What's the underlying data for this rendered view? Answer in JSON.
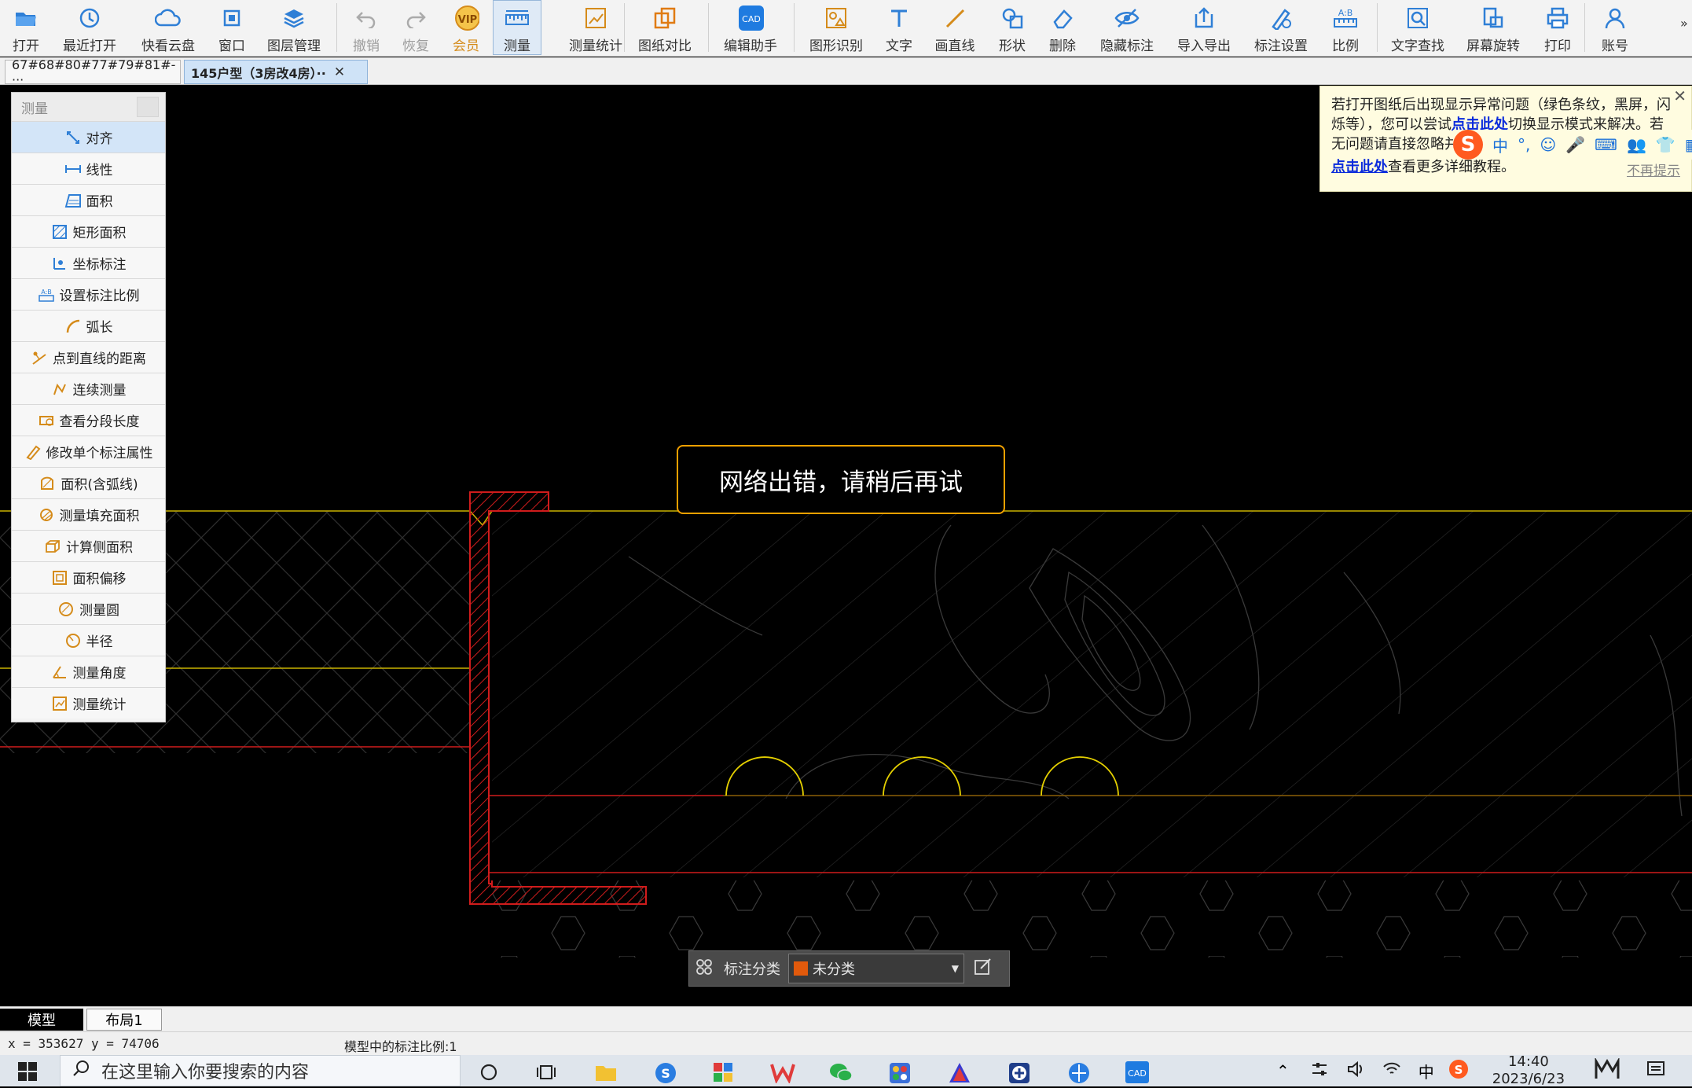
{
  "toolbar": {
    "buttons": [
      {
        "label": "打开",
        "icon": "folder-open-icon"
      },
      {
        "label": "最近打开",
        "icon": "history-icon"
      },
      {
        "label": "快看云盘",
        "icon": "cloud-icon"
      },
      {
        "label": "窗口",
        "icon": "window-icon"
      },
      {
        "label": "图层管理",
        "icon": "layers-icon"
      },
      {
        "label": "撤销",
        "icon": "undo-icon"
      },
      {
        "label": "恢复",
        "icon": "redo-icon"
      },
      {
        "label": "会员",
        "icon": "vip-icon"
      },
      {
        "label": "测量",
        "icon": "ruler-icon"
      },
      {
        "label": "测量统计",
        "icon": "measure-stats-icon"
      },
      {
        "label": "图纸对比",
        "icon": "compare-icon"
      },
      {
        "label": "编辑助手",
        "icon": "cad-edit-icon"
      },
      {
        "label": "图形识别",
        "icon": "shape-recognize-icon"
      },
      {
        "label": "文字",
        "icon": "text-icon"
      },
      {
        "label": "画直线",
        "icon": "line-icon"
      },
      {
        "label": "形状",
        "icon": "shape-icon"
      },
      {
        "label": "删除",
        "icon": "eraser-icon"
      },
      {
        "label": "隐藏标注",
        "icon": "hide-eye-icon"
      },
      {
        "label": "导入导出",
        "icon": "import-export-icon"
      },
      {
        "label": "标注设置",
        "icon": "annotation-settings-icon"
      },
      {
        "label": "比例",
        "icon": "scale-icon"
      },
      {
        "label": "文字查找",
        "icon": "text-search-icon"
      },
      {
        "label": "屏幕旋转",
        "icon": "rotate-screen-icon"
      },
      {
        "label": "打印",
        "icon": "print-icon"
      },
      {
        "label": "账号",
        "icon": "user-icon"
      }
    ],
    "more": "»",
    "vip_badge": "VIP"
  },
  "tabs": [
    {
      "label": "67#68#80#77#79#81#-···",
      "close": "✕"
    },
    {
      "label": "145户型（3房改4房）··",
      "close": "✕"
    }
  ],
  "measure_panel": {
    "title": "测量",
    "items": [
      "对齐",
      "线性",
      "面积",
      "矩形面积",
      "坐标标注",
      "设置标注比例",
      "弧长",
      "点到直线的距离",
      "连续测量",
      "查看分段长度",
      "修改单个标注属性",
      "面积(含弧线)",
      "测量填充面积",
      "计算侧面积",
      "面积偏移",
      "测量圆",
      "半径",
      "测量角度",
      "测量统计"
    ]
  },
  "notice": {
    "line1": "若打开图纸后出现显示异常问题（绿色条纹，黑屏，闪",
    "line2_pre": "烁等），您可以尝试",
    "line2_link": "点击此处",
    "line2_post": "切换显示模式来解决。若",
    "line3": "无问题请直接忽略并",
    "link2": "点击此处",
    "line4_post": "查看更多详细教程。",
    "nomore": "不再提示",
    "close": "✕"
  },
  "ime_toolbar": {
    "logo": "S",
    "items": [
      "中",
      "°,",
      "☺",
      "🎤",
      "⌨",
      "👥",
      "👕",
      "▦"
    ]
  },
  "toast": {
    "message": "网络出错，请稍后再试"
  },
  "category_bar": {
    "label": "标注分类",
    "selected": "未分类",
    "swatch_color": "#e25a0c"
  },
  "layout_tabs": [
    {
      "label": "模型"
    },
    {
      "label": "布局1"
    }
  ],
  "status": {
    "coords": "x = 353627  y = 74706",
    "scale_text": "模型中的标注比例:1"
  },
  "taskbar": {
    "search_placeholder": "在这里输入你要搜索的内容",
    "clock_time": "14:40",
    "clock_date": "2023/6/23",
    "ime_lang": "中"
  }
}
